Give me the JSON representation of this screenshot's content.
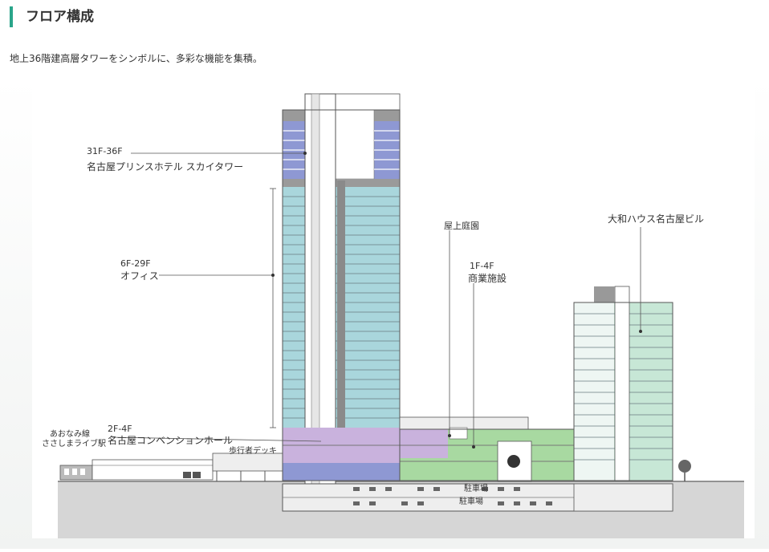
{
  "section": {
    "title": "フロア構成",
    "lead": "地上36階建高層タワーをシンボルに、多彩な機能を集積。"
  },
  "diagram": {
    "labels": {
      "hotel_floors": "31F-36F",
      "hotel_name": "名古屋プリンスホテル スカイタワー",
      "office_floors": "6F-29F",
      "office_name": "オフィス",
      "roof_garden": "屋上庭園",
      "retail_floors": "1F-4F",
      "retail_name": "商業施設",
      "daiwa": "大和ハウス名古屋ビル",
      "station_line": "あおなみ線",
      "station_name": "ささしまライブ駅",
      "conv_floors": "2F-4F",
      "conv_name": "名古屋コンベンションホール",
      "deck": "歩行者デッキ",
      "parking1": "駐車場",
      "parking2": "駐車場"
    },
    "colors": {
      "accent": "#2aa58a",
      "hotel": "#8e98d3",
      "office": "#a9d6dc",
      "convention": "#c9b2dd",
      "retail": "#a8d9a1",
      "daiwa": "#c7e7d6",
      "core": "#8a8a8a",
      "ground": "#d6d6d6"
    }
  }
}
